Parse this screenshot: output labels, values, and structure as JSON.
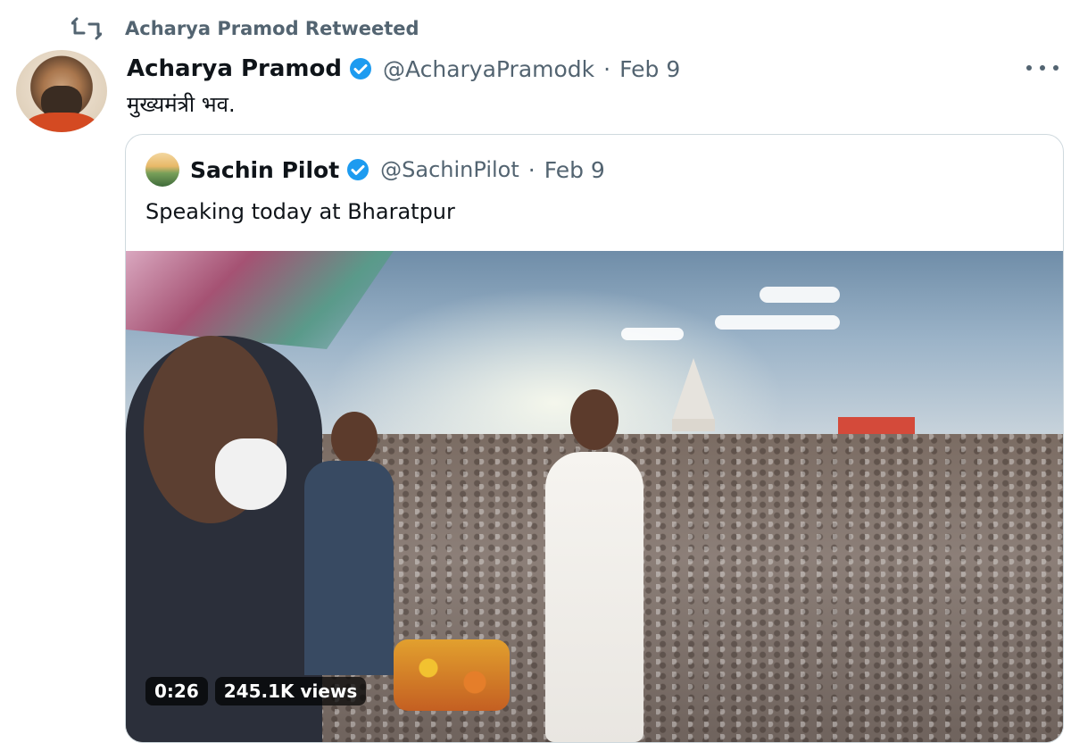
{
  "retweet": {
    "label": "Acharya Pramod Retweeted",
    "icon": "retweet-icon"
  },
  "tweet": {
    "author": {
      "display_name": "Acharya Pramod",
      "handle": "@AcharyaPramodk",
      "verified": true
    },
    "separator": "·",
    "date": "Feb 9",
    "text": "मुख्यमंत्री भव.",
    "more_icon": "more-horizontal-icon"
  },
  "quoted_tweet": {
    "author": {
      "display_name": "Sachin Pilot",
      "handle": "@SachinPilot",
      "verified": true
    },
    "separator": "·",
    "date": "Feb 9",
    "text": "Speaking today at Bharatpur",
    "video": {
      "timestamp": "0:26",
      "views": "245.1K views"
    }
  },
  "colors": {
    "text_primary": "#0f1419",
    "text_secondary": "#536471",
    "verified_blue": "#1d9bf0",
    "border": "#cfd9de"
  }
}
